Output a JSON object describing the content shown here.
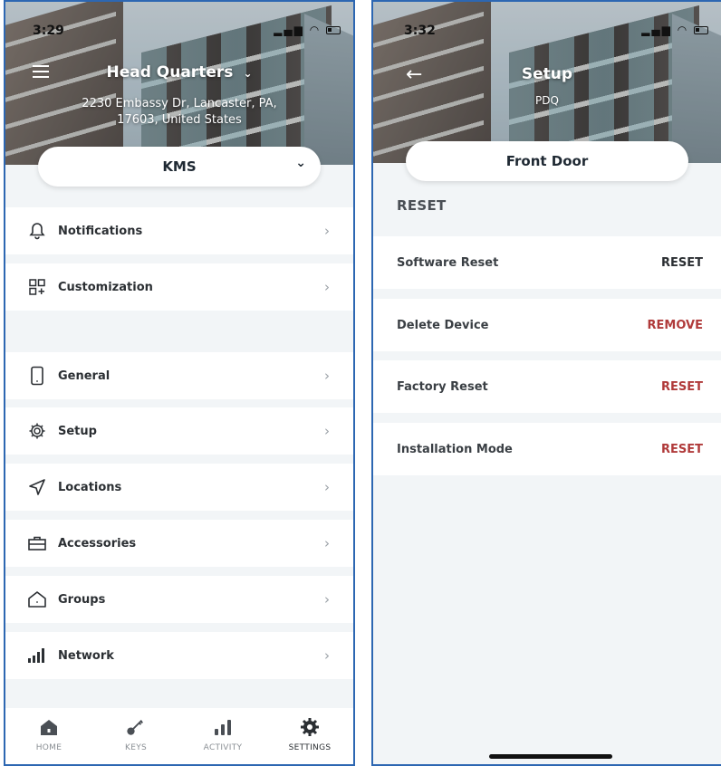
{
  "left": {
    "status": {
      "time": "3:29"
    },
    "header": {
      "title": "Head Quarters",
      "address_line1": "2230 Embassy Dr, Lancaster, PA,",
      "address_line2": "17603, United States"
    },
    "site_selector": {
      "value": "KMS"
    },
    "menu": [
      {
        "label": "Notifications",
        "icon": "bell-icon"
      },
      {
        "label": "Customization",
        "icon": "grid-plus-icon"
      },
      {
        "label": "General",
        "icon": "phone-icon"
      },
      {
        "label": "Setup",
        "icon": "gear-icon"
      },
      {
        "label": "Locations",
        "icon": "location-arrow-icon"
      },
      {
        "label": "Accessories",
        "icon": "toolbox-icon"
      },
      {
        "label": "Groups",
        "icon": "house-icon"
      },
      {
        "label": "Network",
        "icon": "signal-bars-icon"
      }
    ],
    "tabs": [
      {
        "label": "HOME",
        "icon": "home-icon"
      },
      {
        "label": "KEYS",
        "icon": "key-icon"
      },
      {
        "label": "ACTIVITY",
        "icon": "bar-chart-icon"
      },
      {
        "label": "SETTINGS",
        "icon": "gear-icon",
        "active": true
      }
    ]
  },
  "right": {
    "status": {
      "time": "3:32"
    },
    "header": {
      "title": "Setup",
      "subtitle": "PDQ"
    },
    "device_selector": {
      "value": "Front Door"
    },
    "section_title": "RESET",
    "rows": [
      {
        "label": "Software Reset",
        "action": "RESET",
        "action_color": "#2b2f33"
      },
      {
        "label": "Delete Device",
        "action": "REMOVE",
        "action_color": "#b03a3a"
      },
      {
        "label": "Factory Reset",
        "action": "RESET",
        "action_color": "#b03a3a"
      },
      {
        "label": "Installation Mode",
        "action": "RESET",
        "action_color": "#b03a3a"
      }
    ]
  },
  "colors": {
    "frame": "#2d67b2",
    "background": "#f2f5f7",
    "danger": "#b03a3a",
    "text": "#2b2f33"
  }
}
